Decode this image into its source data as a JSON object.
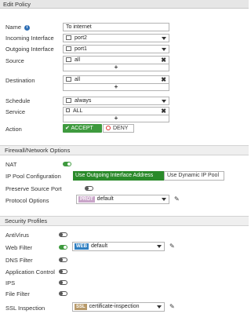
{
  "window": {
    "title": "Edit Policy"
  },
  "policy": {
    "name_label": "Name",
    "name_value": "To internet",
    "incoming_label": "Incoming Interface",
    "incoming_value": "port2",
    "outgoing_label": "Outgoing Interface",
    "outgoing_value": "port1",
    "source_label": "Source",
    "source_value": "all",
    "destination_label": "Destination",
    "destination_value": "all",
    "schedule_label": "Schedule",
    "schedule_value": "always",
    "service_label": "Service",
    "service_value": "ALL",
    "action_label": "Action",
    "accept_label": "ACCEPT",
    "deny_label": "DENY",
    "add_symbol": "+",
    "remove_symbol": "✖"
  },
  "firewall": {
    "header": "Firewall/Network Options",
    "nat_label": "NAT",
    "nat_on": true,
    "ippool_label": "IP Pool Configuration",
    "ippool_options": [
      "Use Outgoing Interface Address",
      "Use Dynamic IP Pool"
    ],
    "preserve_label": "Preserve Source Port",
    "preserve_on": false,
    "protocol_label": "Protocol Options",
    "protocol_badge": "PROT",
    "protocol_value": "default"
  },
  "security": {
    "header": "Security Profiles",
    "antivirus_label": "AntiVirus",
    "webfilter_label": "Web Filter",
    "webfilter_badge": "WEB",
    "webfilter_value": "default",
    "dnsfilter_label": "DNS Filter",
    "appcontrol_label": "Application Control",
    "ips_label": "IPS",
    "filefilter_label": "File Filter",
    "ssl_label": "SSL Inspection",
    "ssl_badge": "SSL",
    "ssl_value": "certificate-inspection"
  },
  "colors": {
    "accent_green": "#3e9a3e",
    "prot_badge": "#c9a5c9",
    "web_badge": "#2f7fc1",
    "ssl_badge": "#b89a6a",
    "info_blue": "#2f6fb5"
  },
  "icons": [
    "info-icon",
    "interface-icon",
    "address-icon",
    "calendar-icon",
    "service-icon",
    "check-icon",
    "deny-icon",
    "pencil-icon",
    "dropdown-arrow-icon",
    "remove-icon",
    "add-icon"
  ]
}
